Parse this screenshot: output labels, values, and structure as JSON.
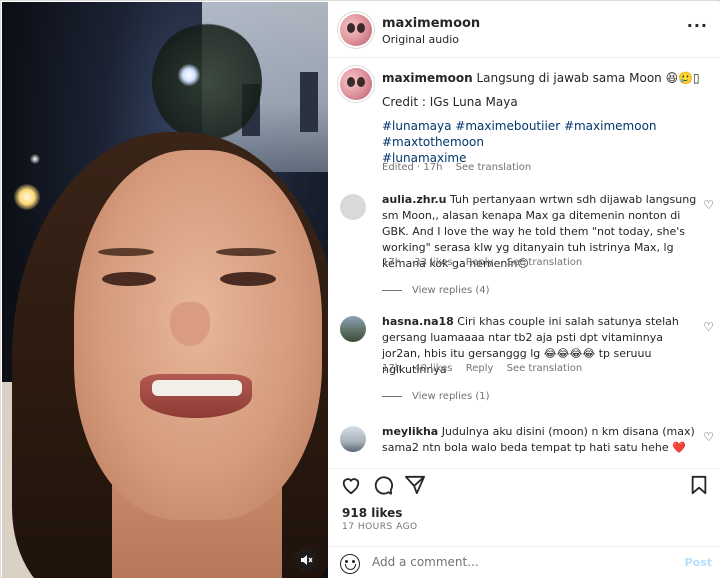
{
  "post": {
    "username": "maximemoon",
    "audio": "Original audio",
    "more_icon": "more-horizontal-icon"
  },
  "caption": {
    "username": "maximemoon",
    "text": "Langsung di jawab sama Moon 😆🥲▯",
    "credit": "Credit : IGs Luna Maya",
    "hashtags_line1": "#lunamaya #maximeboutiier #maximemoon #maxtothemoon",
    "hashtags_line2": "#lunamaxime",
    "edited": "Edited · 17h",
    "see_translation": "See translation"
  },
  "comments": [
    {
      "username": "aulia.zhr.u",
      "text": "Tuh pertanyaan wrtwn sdh dijawab langsung sm Moon,, alasan kenapa Max ga ditemenin nonton di GBK. And I love the way he told them \"not today, she's working\" serasa klw yg ditanyain tuh istrinya Max, lg kemana kok ga nemenin🙃",
      "time": "17h",
      "likes": "33 likes",
      "reply": "Reply",
      "see_translation": "See translation",
      "view_replies": "View replies (4)"
    },
    {
      "username": "hasna.na18",
      "text": "Ciri khas couple ini salah satunya stelah gersang luamaaaa ntar tb2 aja psti dpt vitaminnya jor2an, hbis itu gersanggg lg 😂😂😂😂 tp seruuu ngikutinnya",
      "time": "17h",
      "likes": "40 likes",
      "reply": "Reply",
      "see_translation": "See translation",
      "view_replies": "View replies (1)"
    },
    {
      "username": "meylikha",
      "text": "Judulnya aku disini (moon) n km disana (max) sama2 ntn bola walo beda tempat tp hati satu hehe ❤️"
    }
  ],
  "actions": {
    "likes": "918 likes",
    "time": "17 HOURS AGO"
  },
  "composer": {
    "placeholder": "Add a comment...",
    "post_label": "Post"
  },
  "colors": {
    "hashtag": "#00376b",
    "meta": "#737373",
    "post_disabled": "#b2dffc"
  }
}
